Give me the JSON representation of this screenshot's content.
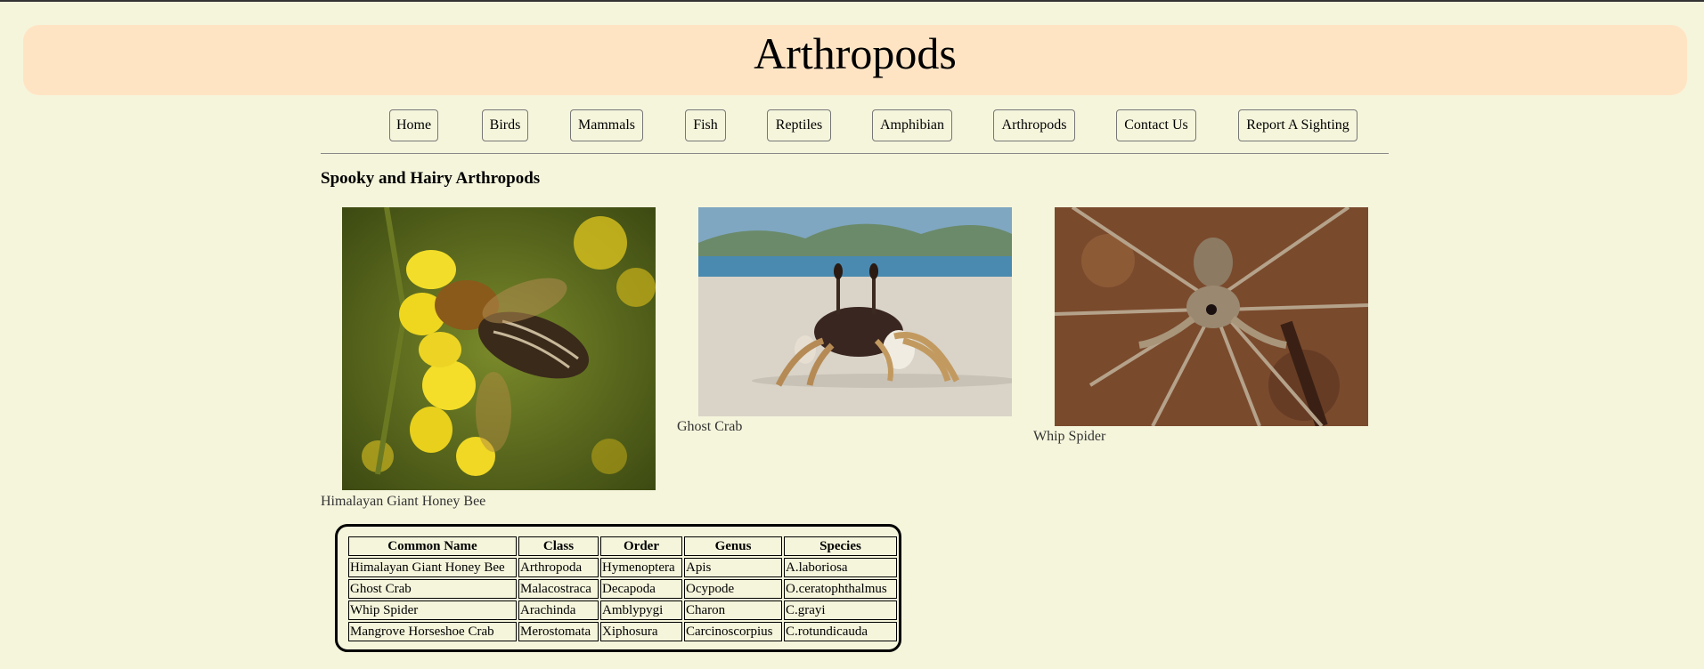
{
  "site": {
    "title": "Arthropods"
  },
  "nav": [
    {
      "label": "Home"
    },
    {
      "label": "Birds"
    },
    {
      "label": "Mammals"
    },
    {
      "label": "Fish"
    },
    {
      "label": "Reptiles"
    },
    {
      "label": "Amphibian"
    },
    {
      "label": "Arthropods"
    },
    {
      "label": "Contact Us"
    },
    {
      "label": "Report A Sighting"
    }
  ],
  "main": {
    "heading": "Spooky and Hairy Arthropods",
    "figures": [
      {
        "caption": "Himalayan Giant Honey Bee",
        "icon": "honey-bee-photo"
      },
      {
        "caption": "Ghost Crab",
        "icon": "ghost-crab-photo"
      },
      {
        "caption": "Whip Spider",
        "icon": "whip-spider-photo"
      }
    ]
  },
  "table": {
    "headers": [
      "Common Name",
      "Class",
      "Order",
      "Genus",
      "Species"
    ],
    "rows": [
      [
        "Himalayan Giant Honey Bee",
        "Arthropoda",
        "Hymenoptera",
        "Apis",
        "A.laboriosa"
      ],
      [
        "Ghost Crab",
        "Malacostraca",
        "Decapoda",
        "Ocypode",
        "O.ceratophthalmus"
      ],
      [
        "Whip Spider",
        "Arachinda",
        "Amblypygi",
        "Charon",
        "C.grayi"
      ],
      [
        "Mangrove Horseshoe Crab",
        "Merostomata",
        "Xiphosura",
        "Carcinoscorpius",
        "C.rotundicauda"
      ]
    ]
  },
  "colors": {
    "background": "#f5f5dc",
    "banner": "#ffe4c4"
  }
}
